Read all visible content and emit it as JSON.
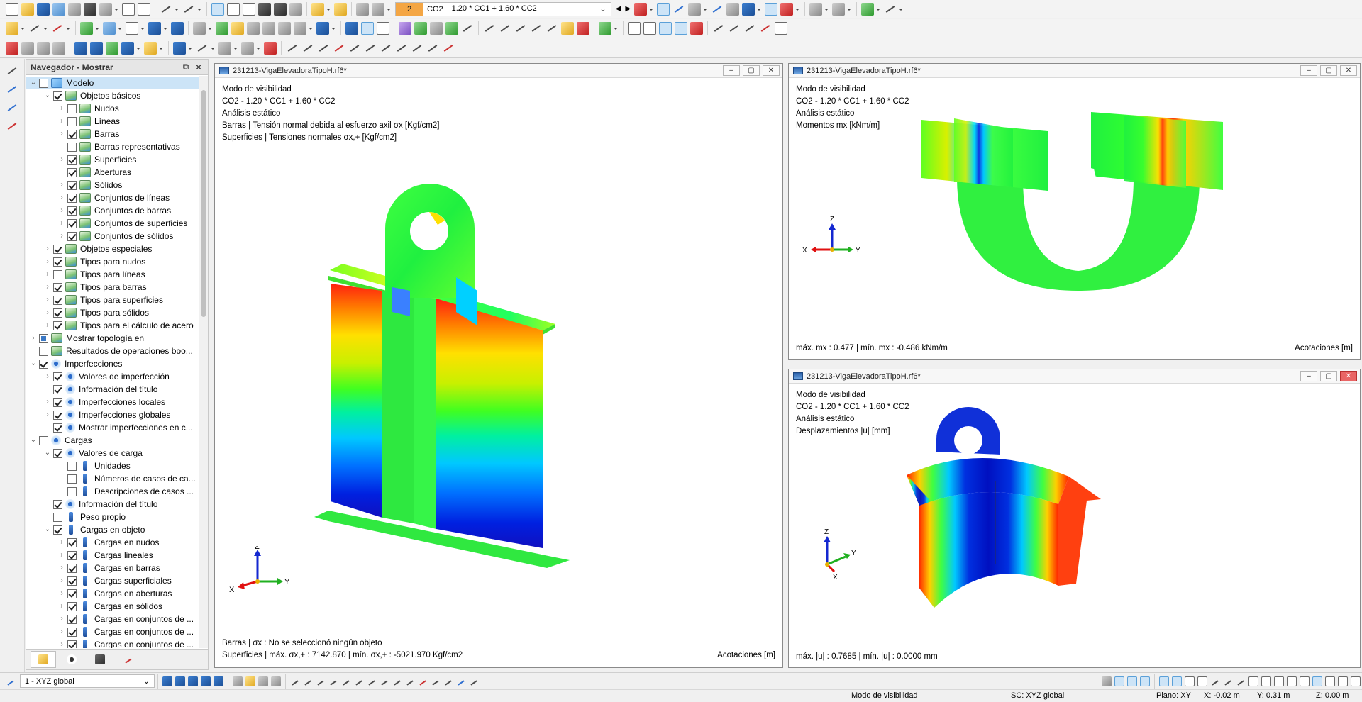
{
  "toolbar": {
    "loadcase_number": "2",
    "loadcase_code": "CO2",
    "loadcase_formula": "1.20 * CC1 + 1.60 * CC2"
  },
  "navigator": {
    "title": "Navegador - Mostrar",
    "items": [
      {
        "label": "Modelo",
        "level": 0,
        "exp": "v",
        "cb": "",
        "icon": "model",
        "sel": true
      },
      {
        "label": "Objetos básicos",
        "level": 1,
        "exp": "v",
        "cb": "on",
        "icon": "gen"
      },
      {
        "label": "Nudos",
        "level": 2,
        "exp": ">",
        "cb": "",
        "icon": "gen"
      },
      {
        "label": "Líneas",
        "level": 2,
        "exp": ">",
        "cb": "",
        "icon": "gen"
      },
      {
        "label": "Barras",
        "level": 2,
        "exp": ">",
        "cb": "on",
        "icon": "gen"
      },
      {
        "label": "Barras representativas",
        "level": 2,
        "exp": "",
        "cb": "",
        "icon": "gen"
      },
      {
        "label": "Superficies",
        "level": 2,
        "exp": ">",
        "cb": "on",
        "icon": "gen"
      },
      {
        "label": "Aberturas",
        "level": 2,
        "exp": "",
        "cb": "on",
        "icon": "gen"
      },
      {
        "label": "Sólidos",
        "level": 2,
        "exp": ">",
        "cb": "on",
        "icon": "gen"
      },
      {
        "label": "Conjuntos de líneas",
        "level": 2,
        "exp": ">",
        "cb": "on",
        "icon": "gen"
      },
      {
        "label": "Conjuntos de barras",
        "level": 2,
        "exp": ">",
        "cb": "on",
        "icon": "gen"
      },
      {
        "label": "Conjuntos de superficies",
        "level": 2,
        "exp": ">",
        "cb": "on",
        "icon": "gen"
      },
      {
        "label": "Conjuntos de sólidos",
        "level": 2,
        "exp": ">",
        "cb": "on",
        "icon": "gen"
      },
      {
        "label": "Objetos especiales",
        "level": 1,
        "exp": ">",
        "cb": "on",
        "icon": "gen"
      },
      {
        "label": "Tipos para nudos",
        "level": 1,
        "exp": ">",
        "cb": "on",
        "icon": "gen"
      },
      {
        "label": "Tipos para líneas",
        "level": 1,
        "exp": ">",
        "cb": "",
        "icon": "gen"
      },
      {
        "label": "Tipos para barras",
        "level": 1,
        "exp": ">",
        "cb": "on",
        "icon": "gen"
      },
      {
        "label": "Tipos para superficies",
        "level": 1,
        "exp": ">",
        "cb": "on",
        "icon": "gen"
      },
      {
        "label": "Tipos para sólidos",
        "level": 1,
        "exp": ">",
        "cb": "on",
        "icon": "gen"
      },
      {
        "label": "Tipos para el cálculo de acero",
        "level": 1,
        "exp": ">",
        "cb": "on",
        "icon": "gen"
      },
      {
        "label": "Mostrar topología en",
        "level": 0,
        "exp": ">",
        "cb": "part",
        "icon": "gen"
      },
      {
        "label": "Resultados de operaciones boo...",
        "level": 0,
        "exp": "",
        "cb": "",
        "icon": "gen"
      },
      {
        "label": "Imperfecciones",
        "level": 0,
        "exp": "v",
        "cb": "on",
        "icon": "eye"
      },
      {
        "label": "Valores de imperfección",
        "level": 1,
        "exp": ">",
        "cb": "on",
        "icon": "eye"
      },
      {
        "label": "Información del título",
        "level": 1,
        "exp": "",
        "cb": "on",
        "icon": "eye"
      },
      {
        "label": "Imperfecciones locales",
        "level": 1,
        "exp": ">",
        "cb": "on",
        "icon": "eye"
      },
      {
        "label": "Imperfecciones globales",
        "level": 1,
        "exp": ">",
        "cb": "on",
        "icon": "eye"
      },
      {
        "label": "Mostrar imperfecciones en c...",
        "level": 1,
        "exp": "",
        "cb": "on",
        "icon": "eye"
      },
      {
        "label": "Cargas",
        "level": 0,
        "exp": "v",
        "cb": "",
        "icon": "eye"
      },
      {
        "label": "Valores de carga",
        "level": 1,
        "exp": "v",
        "cb": "on",
        "icon": "eye"
      },
      {
        "label": "Unidades",
        "level": 2,
        "exp": "",
        "cb": "",
        "icon": "load"
      },
      {
        "label": "Números de casos de ca...",
        "level": 2,
        "exp": "",
        "cb": "",
        "icon": "load"
      },
      {
        "label": "Descripciones de casos ...",
        "level": 2,
        "exp": "",
        "cb": "",
        "icon": "load"
      },
      {
        "label": "Información del título",
        "level": 1,
        "exp": "",
        "cb": "on",
        "icon": "eye"
      },
      {
        "label": "Peso propio",
        "level": 1,
        "exp": "",
        "cb": "",
        "icon": "load"
      },
      {
        "label": "Cargas en objeto",
        "level": 1,
        "exp": "v",
        "cb": "on",
        "icon": "load"
      },
      {
        "label": "Cargas en nudos",
        "level": 2,
        "exp": ">",
        "cb": "on",
        "icon": "load"
      },
      {
        "label": "Cargas lineales",
        "level": 2,
        "exp": ">",
        "cb": "on",
        "icon": "load"
      },
      {
        "label": "Cargas en barras",
        "level": 2,
        "exp": ">",
        "cb": "on",
        "icon": "load"
      },
      {
        "label": "Cargas superficiales",
        "level": 2,
        "exp": ">",
        "cb": "on",
        "icon": "load"
      },
      {
        "label": "Cargas en aberturas",
        "level": 2,
        "exp": ">",
        "cb": "on",
        "icon": "load"
      },
      {
        "label": "Cargas en sólidos",
        "level": 2,
        "exp": ">",
        "cb": "on",
        "icon": "load"
      },
      {
        "label": "Cargas en conjuntos de ...",
        "level": 2,
        "exp": ">",
        "cb": "on",
        "icon": "load"
      },
      {
        "label": "Cargas en conjuntos de ...",
        "level": 2,
        "exp": ">",
        "cb": "on",
        "icon": "load"
      },
      {
        "label": "Cargas en conjuntos de ...",
        "level": 2,
        "exp": ">",
        "cb": "on",
        "icon": "load"
      }
    ]
  },
  "windows": {
    "main": {
      "title": "231213-VigaElevadoraTipoH.rf6*",
      "line1": "Modo de visibilidad",
      "line2": "CO2 - 1.20 * CC1 + 1.60 * CC2",
      "line3": "Análisis estático",
      "line4": "Barras | Tensión normal debida al esfuerzo axil σx [Kgf/cm2]",
      "line5": "Superficies | Tensiones normales σx,+ [Kgf/cm2]",
      "foot1": "Barras | σx : No se seleccionó ningún objeto",
      "foot2": "Superficies | máx. σx,+ : 7142.870 | mín. σx,+ : -5021.970 Kgf/cm2",
      "foot_right": "Acotaciones [m]"
    },
    "top_right": {
      "title": "231213-VigaElevadoraTipoH.rf6*",
      "line1": "Modo de visibilidad",
      "line2": "CO2 - 1.20 * CC1 + 1.60 * CC2",
      "line3": "Análisis estático",
      "line4": "Momentos mx [kNm/m]",
      "foot1": "máx. mx : 0.477 | mín. mx : -0.486 kNm/m",
      "foot_right": "Acotaciones [m]"
    },
    "bottom_right": {
      "title": "231213-VigaElevadoraTipoH.rf6*",
      "line1": "Modo de visibilidad",
      "line2": "CO2 - 1.20 * CC1 + 1.60 * CC2",
      "line3": "Análisis estático",
      "line4": "Desplazamientos |u| [mm]",
      "foot1": "máx. |u| : 0.7685 | mín. |u| : 0.0000 mm"
    }
  },
  "axes": {
    "x": "X",
    "y": "Y",
    "z": "Z"
  },
  "statusbar": {
    "view_select": "1 - XYZ global",
    "mode": "Modo de visibilidad",
    "sc": "SC: XYZ global",
    "plane": "Plano: XY",
    "x": "X: -0.02 m",
    "y": "Y: 0.31 m",
    "z": "Z: 0.00 m"
  }
}
